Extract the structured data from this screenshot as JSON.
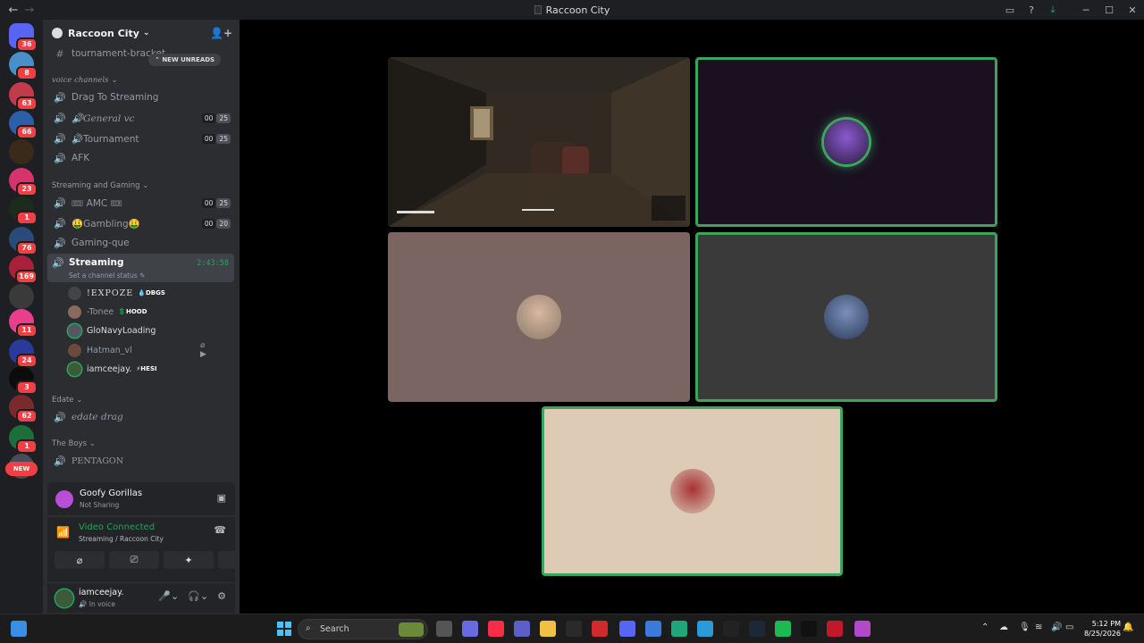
{
  "titlebar": {
    "title": "Raccoon City",
    "back": "←",
    "forward": "→"
  },
  "rail": {
    "servers": [
      {
        "name": "direct-messages",
        "badge": "36",
        "color": "#5865f2"
      },
      {
        "name": "server-2",
        "badge": "8",
        "color": "#4a8fc9"
      },
      {
        "name": "server-3",
        "badge": "63",
        "color": "#c23b4a"
      },
      {
        "name": "server-4",
        "badge": "66",
        "color": "#2d5fa8"
      },
      {
        "name": "server-5",
        "badge": "",
        "color": "#3a2a18"
      },
      {
        "name": "server-6",
        "badge": "23",
        "color": "#d6336c"
      },
      {
        "name": "server-7",
        "badge": "1",
        "color": "#1d2b1d"
      },
      {
        "name": "server-8",
        "badge": "76",
        "color": "#2a4a78"
      },
      {
        "name": "server-9",
        "badge": "169",
        "color": "#a8203a"
      },
      {
        "name": "server-10",
        "badge": "",
        "color": "#3a3a3a"
      },
      {
        "name": "server-11",
        "badge": "11",
        "color": "#e83e8c"
      },
      {
        "name": "server-12",
        "badge": "24",
        "color": "#2a3a9a"
      },
      {
        "name": "server-13",
        "badge": "3",
        "color": "#0c0c0c"
      },
      {
        "name": "server-14",
        "badge": "62",
        "color": "#7a2a2a"
      },
      {
        "name": "server-15",
        "badge": "1",
        "color": "#1e6e3c"
      },
      {
        "name": "server-16",
        "badge": "",
        "color": "#4a4a5a"
      }
    ],
    "new_label": "NEW"
  },
  "sidebar": {
    "guild_name": "Raccoon City",
    "top_channel": "tournament-bracket",
    "new_unreads": "NEW UNREADS",
    "cat_voice": "voice channels",
    "channels_voice": [
      {
        "label": "Drag To Streaming",
        "italic": false,
        "counts": null
      },
      {
        "label": "🔊General vc",
        "italic": true,
        "counts": [
          "00",
          "25"
        ]
      },
      {
        "label": "🔊Tournament",
        "italic": false,
        "counts": [
          "00",
          "25"
        ]
      },
      {
        "label": "AFK",
        "italic": false,
        "counts": null
      }
    ],
    "cat_streaming": "Streaming and Gaming",
    "channels_stream": [
      {
        "label": "🎟 AMC 🎟",
        "counts": [
          "00",
          "25"
        ]
      },
      {
        "label": "🤑Gambling🤑",
        "counts": [
          "00",
          "20"
        ]
      },
      {
        "label": "Gaming-que",
        "counts": null
      }
    ],
    "active_channel": {
      "label": "Streaming",
      "status": "Set a channel status ✎",
      "timer": "2:43:58"
    },
    "members": [
      {
        "name": "!EXPOZE",
        "tag": "💧DBGS",
        "speaking": false,
        "dim": false,
        "color": "#444"
      },
      {
        "name": "-Tonee",
        "tag": "💲HOOD",
        "speaking": false,
        "dim": true,
        "color": "#8a6a5a"
      },
      {
        "name": "GloNavyLoading",
        "tag": "",
        "speaking": true,
        "dim": false,
        "color": "#556"
      },
      {
        "name": "Hatman_vl",
        "tag": "",
        "speaking": false,
        "dim": true,
        "color": "#6a4a3a"
      },
      {
        "name": "iamceejay.",
        "tag": "⚡HESI",
        "speaking": true,
        "dim": false,
        "color": "#3a5a3a"
      }
    ],
    "cat_edate": "Edate",
    "ch_edate": "edate drag",
    "cat_boys": "The Boys",
    "ch_pentagon": "PENTAGON"
  },
  "panel": {
    "activity_name": "Goofy Gorillas",
    "activity_status": "Not Sharing",
    "voice_status": "Video Connected",
    "voice_location": "Streaming / Raccoon City",
    "username": "iamceejay.",
    "user_status": "In voice"
  },
  "taskbar": {
    "search_placeholder": "Search",
    "time": "5:12 PM",
    "date": "8/25/2026"
  }
}
